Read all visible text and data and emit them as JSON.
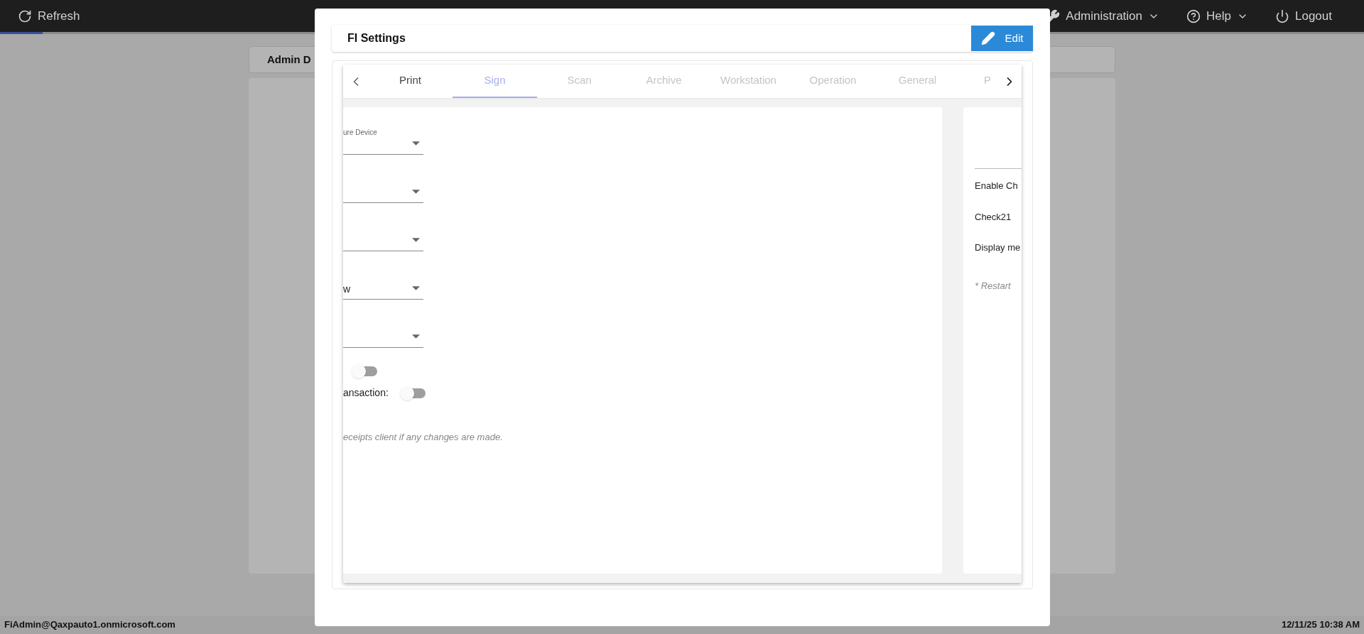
{
  "top_bar": {
    "refresh": "Refresh",
    "menus": [
      {
        "label": "Administration",
        "kind": "wrench"
      },
      {
        "label": "Help",
        "kind": "help"
      }
    ],
    "logout": "Logout"
  },
  "background": {
    "card_title": "Admin D"
  },
  "dialog": {
    "title": "FI Settings",
    "edit_button": "Edit",
    "tabs": [
      {
        "label": "Print",
        "selected": false,
        "disabled": false
      },
      {
        "label": "Sign",
        "selected": true,
        "disabled": false
      },
      {
        "label": "Scan",
        "selected": false,
        "disabled": true
      },
      {
        "label": "Archive",
        "selected": false,
        "disabled": true
      },
      {
        "label": "Workstation",
        "selected": false,
        "disabled": true
      },
      {
        "label": "Operation",
        "selected": false,
        "disabled": true
      },
      {
        "label": "General",
        "selected": false,
        "disabled": true
      },
      {
        "label": "P",
        "selected": false,
        "disabled": true
      }
    ],
    "left_panel": {
      "selects": [
        {
          "kind": "select",
          "label": "ure Device"
        },
        {
          "kind": "select"
        },
        {
          "kind": "select"
        },
        {
          "kind": "select",
          "value": "w"
        },
        {
          "kind": "select"
        }
      ],
      "toggles": [
        {
          "on": false
        },
        {
          "label": "ansaction:",
          "on": false
        }
      ],
      "note": "eceipts client if any changes are made."
    },
    "right_panel": {
      "items": [
        "Enable Ch",
        "Check21",
        "Display me"
      ],
      "note": "* Restart"
    }
  },
  "status_bar": {
    "user": "FiAdmin@Qaxpauto1.onmicrosoft.com",
    "datetime": "12/11/25 10:38 AM"
  }
}
